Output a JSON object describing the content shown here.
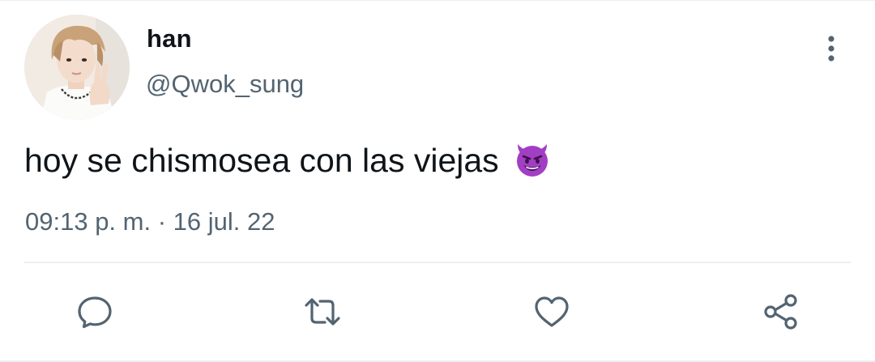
{
  "tweet": {
    "display_name": "han",
    "handle": "@Qwok_sung",
    "text": "hoy se chismosea con las viejas",
    "emoji": "smiling-face-with-horns",
    "time": "09:13 p. m.",
    "separator": "·",
    "date": "16 jul. 22"
  },
  "icons": {
    "more": "more-vertical-icon",
    "reply": "reply-icon",
    "retweet": "retweet-icon",
    "like": "heart-icon",
    "share": "share-icon"
  },
  "colors": {
    "text_primary": "#0f1419",
    "text_secondary": "#536471",
    "icon": "#536471",
    "divider": "#eceff1",
    "emoji_purple": "#a23ec4"
  }
}
